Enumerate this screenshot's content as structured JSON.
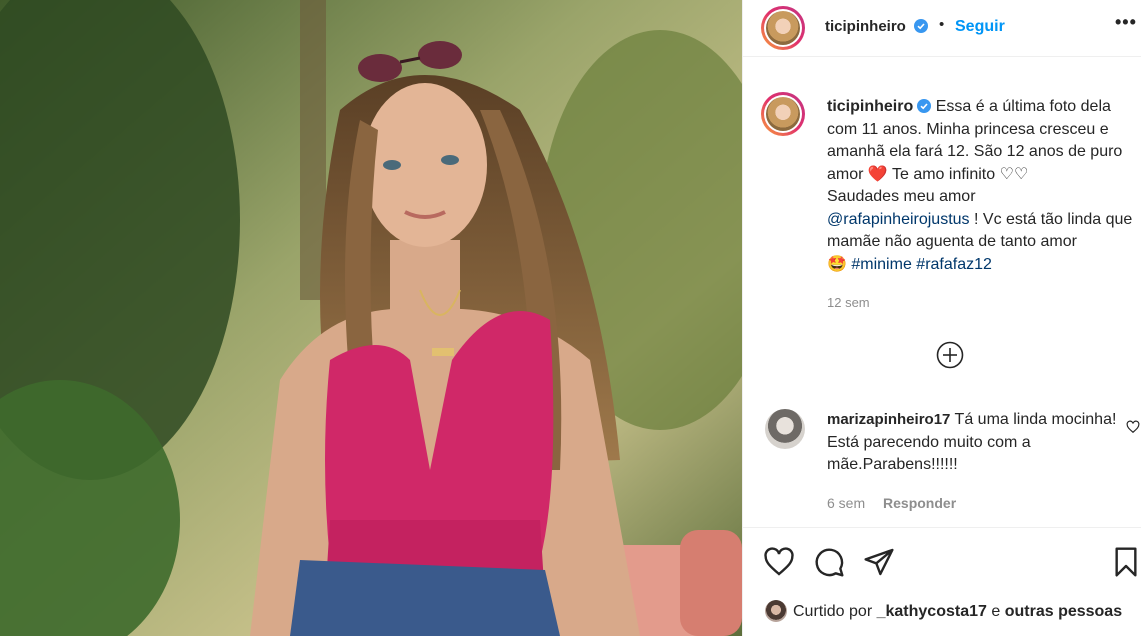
{
  "post": {
    "image_alt": "girl in pink top with sunglasses on head in a garden",
    "author": "ticipinheiro",
    "follow_label": "Seguir",
    "separator": "•",
    "more_label": "•••"
  },
  "caption": {
    "username": "ticipinheiro",
    "text_1": "Essa é a última foto dela com 11 anos. Minha princesa cresceu e amanhã ela fará 12. São 12 anos de puro amor",
    "heart_emoji": "❤️",
    "text_2": "Te amo infinito",
    "white_hearts": "♡♡",
    "text_3": "Saudades meu amor",
    "mention": "@rafapinheirojustus",
    "text_4": "! Vc está tão linda que mamãe não aguenta de tanto amor",
    "star_emoji": "🤩",
    "hashtag_1": "#minime",
    "hashtag_2": "#rafafaz12",
    "time": "12 sem"
  },
  "comment": {
    "username": "marizapinheiro17",
    "text": "Tá uma linda mocinha! Está parecendo muito com a mãe.Parabens!!!!!!",
    "time": "6 sem",
    "reply_label": "Responder"
  },
  "likes": {
    "prefix": "Curtido por",
    "user": "_kathycosta17",
    "connector": "e",
    "others": "outras pessoas"
  },
  "colors": {
    "accent": "#0095f6",
    "link": "#00376b",
    "muted": "#8e8e8e",
    "heart": "#e0245e"
  },
  "icons": [
    "verified-icon",
    "more-icon",
    "plus-circle-icon",
    "like-icon",
    "comment-icon",
    "share-icon",
    "save-icon",
    "heart-small-icon"
  ]
}
